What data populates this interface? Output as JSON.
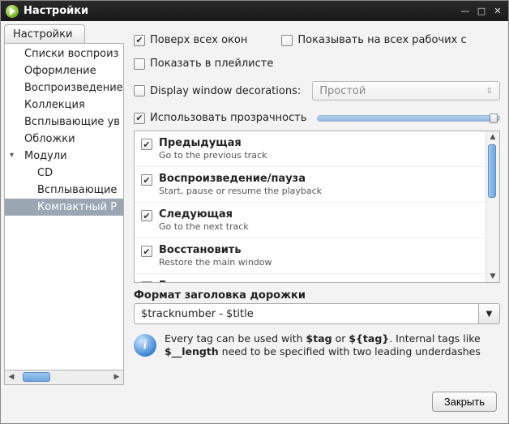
{
  "window": {
    "title": "Настройки"
  },
  "sidebar": {
    "tab_label": "Настройки",
    "items": [
      {
        "label": "Списки воспроиз",
        "level": 1
      },
      {
        "label": "Оформление",
        "level": 1
      },
      {
        "label": "Воспроизведение",
        "level": 1
      },
      {
        "label": "Коллекция",
        "level": 1
      },
      {
        "label": "Всплывающие ув",
        "level": 1
      },
      {
        "label": "Обложки",
        "level": 1
      },
      {
        "label": "Модули",
        "level": 1,
        "expander": "▾"
      },
      {
        "label": "CD",
        "level": 2
      },
      {
        "label": "Всплывающие",
        "level": 2
      },
      {
        "label": "Компактный Р",
        "level": 2,
        "selected": true
      }
    ]
  },
  "options": {
    "on_top": "Поверх всех окон",
    "show_all_ws": "Показывать на всех рабочих с",
    "show_in_playlist": "Показать в плейлисте",
    "window_decorations": "Display window decorations:",
    "decoration_style": "Простой",
    "use_transparency": "Использовать прозрачность"
  },
  "tracks": [
    {
      "title": "Предыдущая",
      "sub": "Go to the previous track",
      "checked": true
    },
    {
      "title": "Воспроизведение/пауза",
      "sub": "Start, pause or resume the playback",
      "checked": true
    },
    {
      "title": "Следующая",
      "sub": "Go to the next track",
      "checked": true
    },
    {
      "title": "Восстановить",
      "sub": "Restore the main window",
      "checked": true
    },
    {
      "title": "Громкость",
      "sub": "",
      "checked": false
    }
  ],
  "format": {
    "label": "Формат заголовка дорожки",
    "value": "$tracknumber - $title"
  },
  "info": {
    "pre": "Every tag can be used with ",
    "b1": "$tag",
    "mid": " or ",
    "b2": "${tag}",
    "post1": ". Internal tags like ",
    "b3": "$__length",
    "post2": " need to be specified with two leading underdashes"
  },
  "footer": {
    "close": "Закрыть"
  }
}
